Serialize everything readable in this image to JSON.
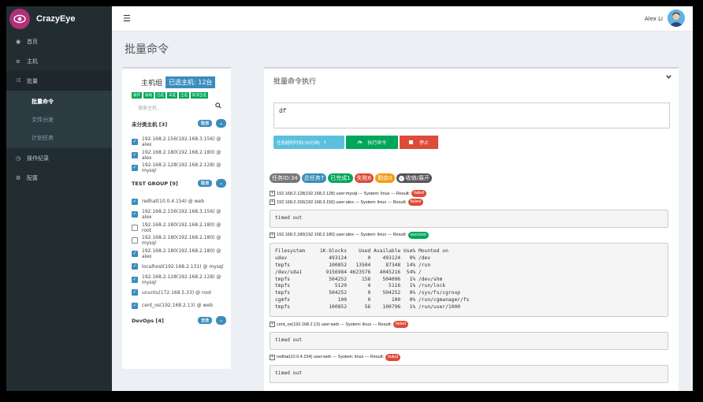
{
  "app": {
    "name": "CrazyEye",
    "page_title": "批量命令"
  },
  "header": {
    "menu_icon": "hamburger-icon",
    "user": "Alex Li"
  },
  "sidebar": {
    "items": [
      {
        "icon": "dashboard-icon",
        "label": "首页"
      },
      {
        "icon": "list-icon",
        "label": "主机"
      },
      {
        "icon": "shuffle-icon",
        "label": "批量",
        "open": true
      },
      {
        "icon": "clock-icon",
        "label": "操作纪录"
      },
      {
        "icon": "gear-icon",
        "label": "配置"
      }
    ],
    "sub_items": [
      {
        "label": "批量命令",
        "active": true
      },
      {
        "label": "文件分发"
      },
      {
        "label": "计划任务"
      }
    ]
  },
  "host_panel": {
    "title": "主机组",
    "selected": "已选主机: 12台",
    "mini_buttons": [
      "展开",
      "收缩",
      "已选",
      "未选",
      "全选",
      "取消全选"
    ],
    "search_placeholder": "搜索主机...",
    "groups": [
      {
        "name": "未分类主机 [3]",
        "button": "取消",
        "hosts": [
          {
            "label": "192.168.2.156(192.168.3.156) @ alex",
            "checked": true
          },
          {
            "label": "192.168.2.180(192.168.2.180) @ alex",
            "checked": true
          },
          {
            "label": "192.168.2.128(192.168.2.128) @ mysql",
            "checked": true
          }
        ]
      },
      {
        "name": "TEST GROUP [9]",
        "button": "取消",
        "hosts": [
          {
            "label": "redhat(10.0.4.154) @ web",
            "checked": true
          },
          {
            "label": "192.168.2.156(192.168.3.156) @ alex",
            "checked": true
          },
          {
            "label": "192.168.2.180(192.168.2.180) @ root",
            "checked": false
          },
          {
            "label": "192.168.2.180(192.168.2.180) @ mysql",
            "checked": false
          },
          {
            "label": "192.168.2.180(192.168.2.180) @ alex",
            "checked": true
          },
          {
            "label": "localhost(192.168.2.131) @ mysql",
            "checked": true
          },
          {
            "label": "192.168.2.128(192.168.2.128) @ mysql",
            "checked": true
          },
          {
            "label": "ununtu(172.168.5.33) @ root",
            "checked": true
          },
          {
            "label": "cent_os(192.168.2.13) @ web",
            "checked": true
          }
        ]
      },
      {
        "name": "DevOps [4]",
        "button": "全选",
        "hosts": []
      }
    ]
  },
  "cmd_panel": {
    "title": "批量命令执行",
    "command": "df",
    "timeout_label": "任务超时时间(30分钟)",
    "run_label": "执行命令",
    "stop_label": "停止",
    "stats": [
      {
        "label": "任务ID:34",
        "color": "#777777"
      },
      {
        "label": "总任务7",
        "color": "#3c8dbc"
      },
      {
        "label": "已完成1",
        "color": "#00a65a"
      },
      {
        "label": "失败6",
        "color": "#dd4b39"
      },
      {
        "label": "剩余0",
        "color": "#f39c12"
      },
      {
        "label": "收缩/展开",
        "color": "#555555"
      }
    ],
    "results": [
      {
        "host": "192.168.2.128(192.168.2.128) user:mysql --- System: linux --- Result:",
        "status": "failed",
        "output": null
      },
      {
        "host": "192.168.2.156(192.168.3.156) user:alex --- System: linux --- Result:",
        "status": "failed",
        "output": "timed out"
      },
      {
        "host": "192.168.2.180(192.168.2.180) user:alex --- System: linux --- Result:",
        "status": "success",
        "output": "Filesystem     1K-blocks    Used Available Use% Mounted on\nudev              493124       0    493124   0% /dev\ntmpfs             100852   13504     87348  14% /run\n/dev/sda1        9156984 4623576   4045216  54% /\ntmpfs             504252     156    504096   1% /dev/shm\ntmpfs               5120       4      5116   1% /run/lock\ntmpfs             504252       0    504252   0% /sys/fs/cgroup\ncgmfs                100       0       100   0% /run/cgmanager/fs\ntmpfs             100852      56    100796   1% /run/user/1000"
      },
      {
        "host": "cent_os(192.168.2.13) user:web --- System: linux --- Result:",
        "status": "failed",
        "output": "timed out"
      },
      {
        "host": "redhat(10.0.4.154) user:web --- System: linux --- Result:",
        "status": "failed",
        "output": "timed out"
      }
    ]
  }
}
